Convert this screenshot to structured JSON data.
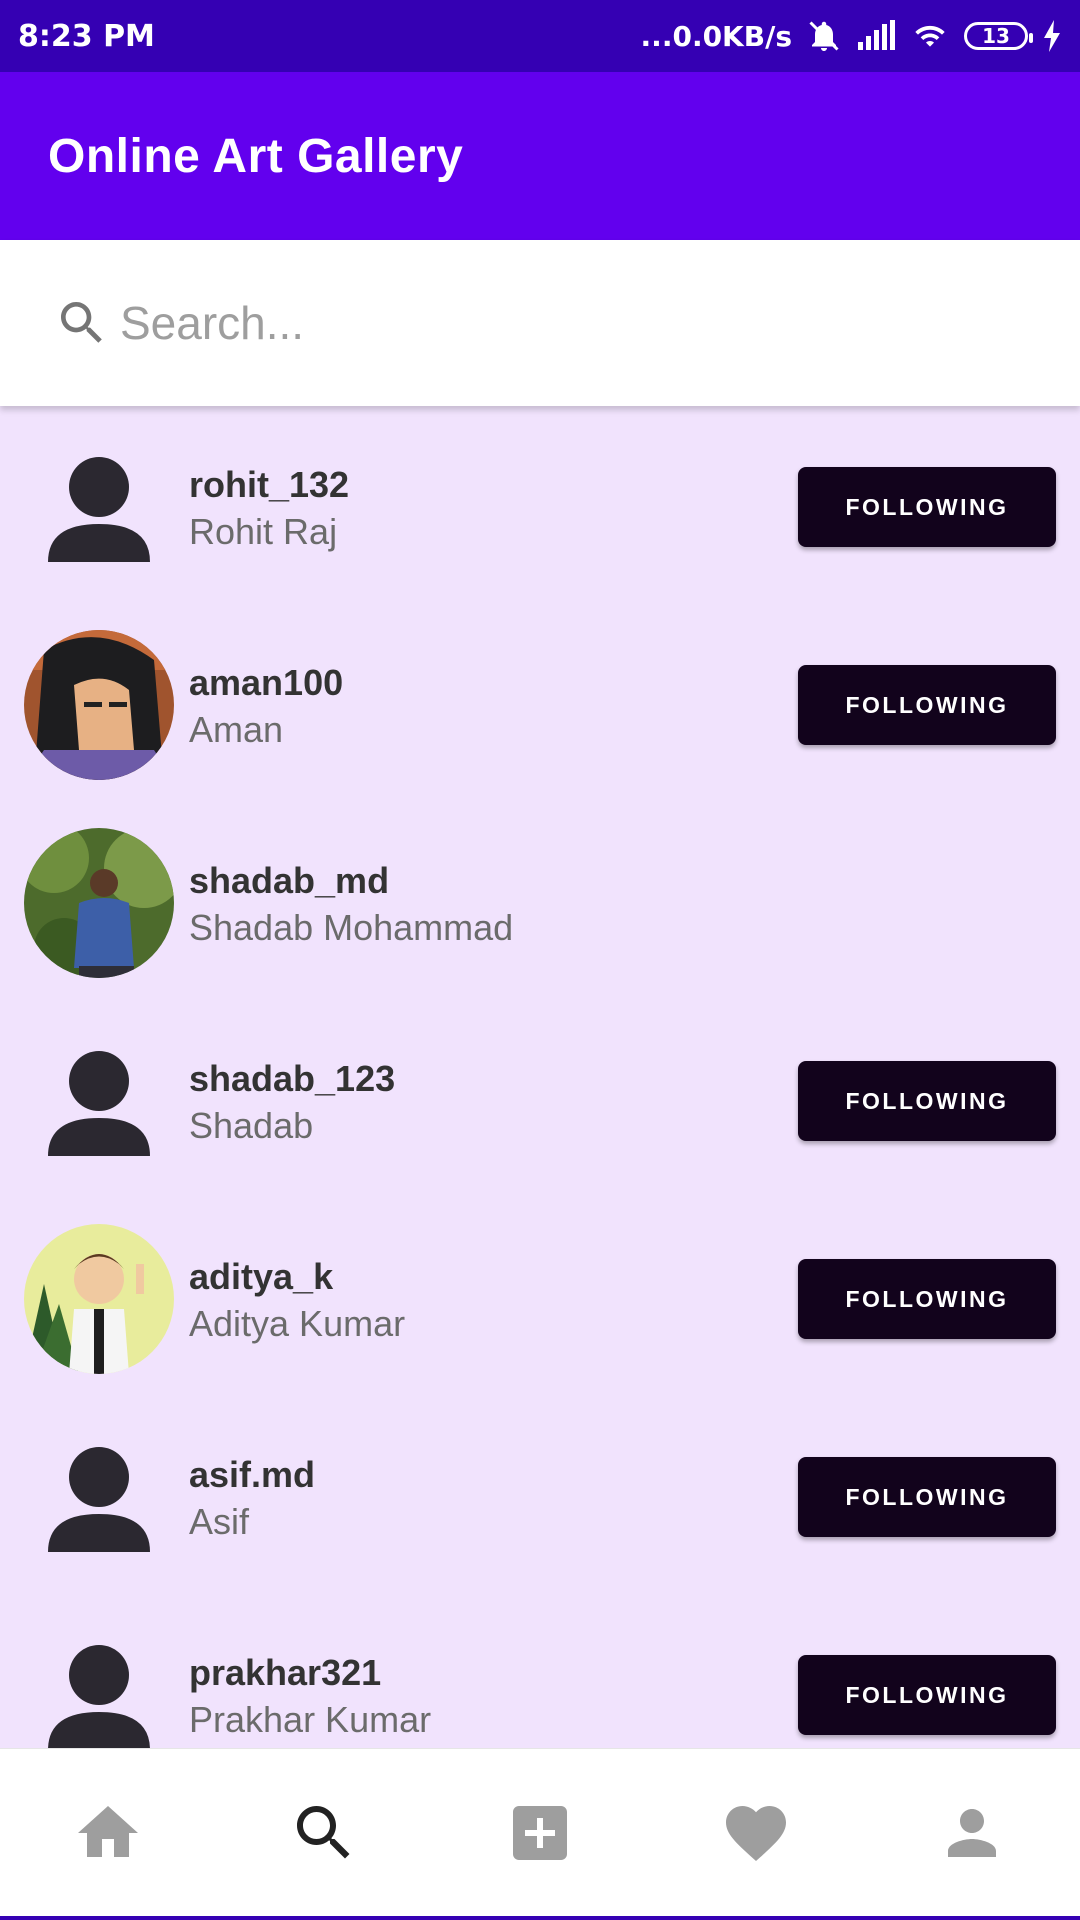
{
  "status_bar": {
    "time": "8:23 PM",
    "network_speed": "...0.0KB/s",
    "battery": "13"
  },
  "app_bar": {
    "title": "Online Art Gallery"
  },
  "search": {
    "placeholder": "Search..."
  },
  "users": [
    {
      "username": "rohit_132",
      "name": "Rohit Raj",
      "avatar": "default-person-icon",
      "button": "FOLLOWING"
    },
    {
      "username": "aman100",
      "name": "Aman",
      "avatar": "cartoon-character-photo",
      "button": "FOLLOWING"
    },
    {
      "username": "shadab_md",
      "name": "Shadab Mohammad",
      "avatar": "person-photo",
      "button": ""
    },
    {
      "username": "shadab_123",
      "name": "Shadab",
      "avatar": "default-person-icon",
      "button": "FOLLOWING"
    },
    {
      "username": "aditya_k",
      "name": "Aditya Kumar",
      "avatar": "cartoon-boy-photo",
      "button": "FOLLOWING"
    },
    {
      "username": "asif.md",
      "name": "Asif",
      "avatar": "default-person-icon",
      "button": "FOLLOWING"
    },
    {
      "username": "prakhar321",
      "name": "Prakhar Kumar",
      "avatar": "default-person-icon",
      "button": "FOLLOWING"
    }
  ],
  "bottom_nav": [
    {
      "icon": "home-icon",
      "active": false
    },
    {
      "icon": "search-icon",
      "active": true
    },
    {
      "icon": "add-box-icon",
      "active": false
    },
    {
      "icon": "heart-icon",
      "active": false
    },
    {
      "icon": "person-icon",
      "active": false
    }
  ],
  "colors": {
    "status_bar": "#3500b3",
    "app_bar": "#6200ee",
    "list_background": "#f1e3fd",
    "button": "#12031c",
    "nav_inactive": "#9e9e9e",
    "nav_active": "#222222"
  }
}
